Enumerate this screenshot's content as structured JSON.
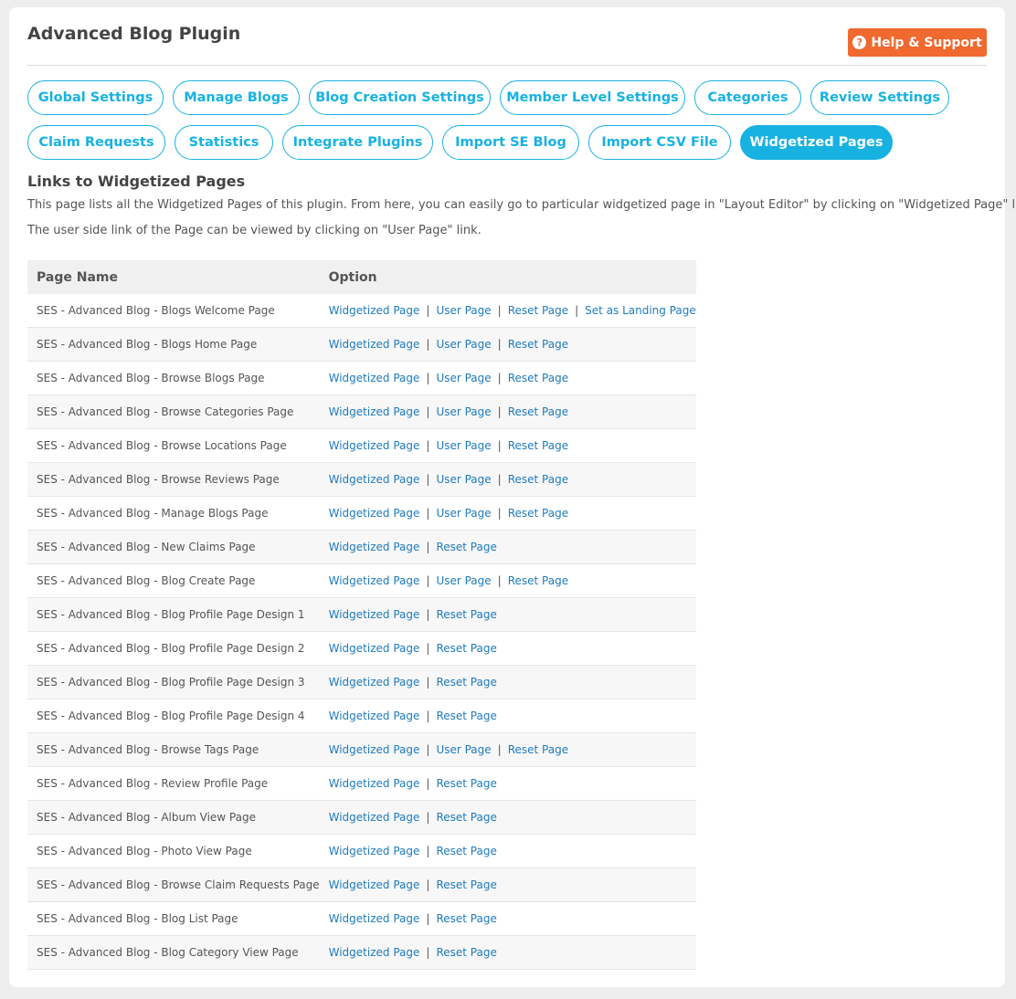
{
  "header": {
    "title": "Advanced Blog Plugin",
    "help_label": "Help & Support",
    "help_icon": "question-circle-icon",
    "help_color": "#f0692f"
  },
  "tabs": {
    "row1": [
      {
        "label": "Global Settings",
        "active": false
      },
      {
        "label": "Manage Blogs",
        "active": false
      },
      {
        "label": "Blog Creation Settings",
        "active": false
      },
      {
        "label": "Member Level Settings",
        "active": false
      },
      {
        "label": "Categories",
        "active": false
      },
      {
        "label": "Review Settings",
        "active": false
      }
    ],
    "row2": [
      {
        "label": "Claim Requests",
        "active": false
      },
      {
        "label": "Statistics",
        "active": false
      },
      {
        "label": "Integrate Plugins",
        "active": false
      },
      {
        "label": "Import SE Blog",
        "active": false
      },
      {
        "label": "Import CSV File",
        "active": false
      },
      {
        "label": "Widgetized Pages",
        "active": true
      }
    ],
    "accent_color": "#17b2e2"
  },
  "section": {
    "title": "Links to Widgetized Pages",
    "description_1": "This page lists all the Widgetized Pages of this plugin. From here, you can easily go to particular widgetized page in \"Layout Editor\" by clicking on \"Widgetized Page\" link.",
    "description_2": "The user side link of the Page can be viewed by clicking on \"User Page\" link."
  },
  "table": {
    "headers": {
      "page_name": "Page Name",
      "option": "Option"
    },
    "link_color": "#1f7bbf",
    "rows": [
      {
        "name": "SES - Advanced Blog - Blogs Welcome Page",
        "options": [
          "Widgetized Page",
          "User Page",
          "Reset Page",
          "Set as Landing Page"
        ]
      },
      {
        "name": "SES - Advanced Blog - Blogs Home Page",
        "options": [
          "Widgetized Page",
          "User Page",
          "Reset Page"
        ]
      },
      {
        "name": "SES - Advanced Blog - Browse Blogs Page",
        "options": [
          "Widgetized Page",
          "User Page",
          "Reset Page"
        ]
      },
      {
        "name": "SES - Advanced Blog - Browse Categories Page",
        "options": [
          "Widgetized Page",
          "User Page",
          "Reset Page"
        ]
      },
      {
        "name": "SES - Advanced Blog - Browse Locations Page",
        "options": [
          "Widgetized Page",
          "User Page",
          "Reset Page"
        ]
      },
      {
        "name": "SES - Advanced Blog - Browse Reviews Page",
        "options": [
          "Widgetized Page",
          "User Page",
          "Reset Page"
        ]
      },
      {
        "name": "SES - Advanced Blog - Manage Blogs Page",
        "options": [
          "Widgetized Page",
          "User Page",
          "Reset Page"
        ]
      },
      {
        "name": "SES - Advanced Blog - New Claims Page",
        "options": [
          "Widgetized Page",
          "Reset Page"
        ]
      },
      {
        "name": "SES - Advanced Blog - Blog Create Page",
        "options": [
          "Widgetized Page",
          "User Page",
          "Reset Page"
        ]
      },
      {
        "name": "SES - Advanced Blog - Blog Profile Page Design 1",
        "options": [
          "Widgetized Page",
          "Reset Page"
        ]
      },
      {
        "name": "SES - Advanced Blog - Blog Profile Page Design 2",
        "options": [
          "Widgetized Page",
          "Reset Page"
        ]
      },
      {
        "name": "SES - Advanced Blog - Blog Profile Page Design 3",
        "options": [
          "Widgetized Page",
          "Reset Page"
        ]
      },
      {
        "name": "SES - Advanced Blog - Blog Profile Page Design 4",
        "options": [
          "Widgetized Page",
          "Reset Page"
        ]
      },
      {
        "name": "SES - Advanced Blog - Browse Tags Page",
        "options": [
          "Widgetized Page",
          "User Page",
          "Reset Page"
        ]
      },
      {
        "name": "SES - Advanced Blog - Review Profile Page",
        "options": [
          "Widgetized Page",
          "Reset Page"
        ]
      },
      {
        "name": "SES - Advanced Blog - Album View Page",
        "options": [
          "Widgetized Page",
          "Reset Page"
        ]
      },
      {
        "name": "SES - Advanced Blog - Photo View Page",
        "options": [
          "Widgetized Page",
          "Reset Page"
        ]
      },
      {
        "name": "SES - Advanced Blog - Browse Claim Requests Page",
        "options": [
          "Widgetized Page",
          "Reset Page"
        ]
      },
      {
        "name": "SES - Advanced Blog - Blog List Page",
        "options": [
          "Widgetized Page",
          "Reset Page"
        ]
      },
      {
        "name": "SES - Advanced Blog - Blog Category View Page",
        "options": [
          "Widgetized Page",
          "Reset Page"
        ]
      }
    ]
  }
}
